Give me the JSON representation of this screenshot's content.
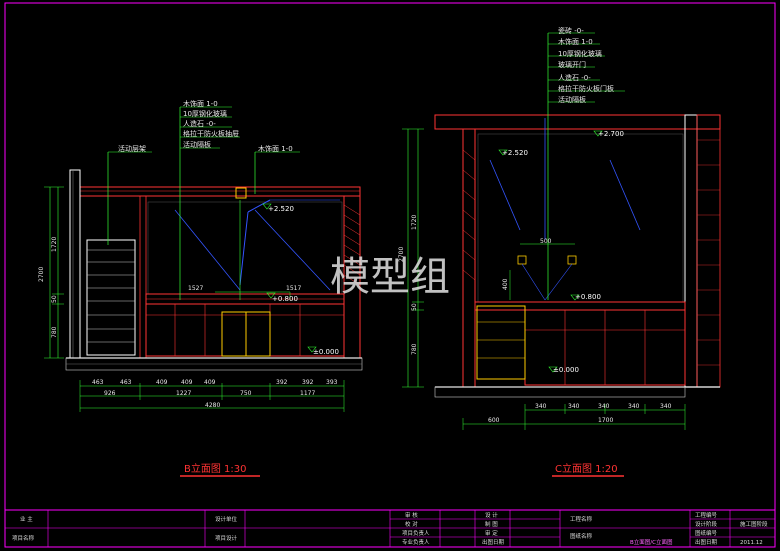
{
  "watermark": "模型组",
  "left_elevation": {
    "title": "B立面图 1:30",
    "callouts": [
      "木饰面 1-0",
      "10厚钢化玻璃",
      "人造石 -0-",
      "格拉干防火板抽屉",
      "活动隔板"
    ],
    "callout_left": "活动层架",
    "callout_right": "木饰面 1-0",
    "levels": [
      "+2.520",
      "+0.800",
      "±0.000"
    ],
    "dims_top": [
      "1527",
      "1517"
    ],
    "dims_row1": [
      "463",
      "463",
      "409",
      "409",
      "409",
      "392",
      "392",
      "393"
    ],
    "dims_row2": [
      "926",
      "1227",
      "750",
      "1177"
    ],
    "dims_total": "4280",
    "dims_vert": [
      "2700",
      "1720",
      "50",
      "780"
    ]
  },
  "right_elevation": {
    "title": "C立面图 1:20",
    "callouts": [
      "瓷砖 -0-",
      "木饰面 1-0",
      "10厚钢化玻璃",
      "玻璃开门",
      "人造石 -0-",
      "格拉干防火板门板",
      "活动隔板"
    ],
    "levels": [
      "+2.700",
      "+2.520",
      "+0.800",
      "±0.000"
    ],
    "dims_mid": [
      "500",
      "400"
    ],
    "dims_row1": [
      "340",
      "340",
      "340",
      "340",
      "340"
    ],
    "dims_row2": [
      "600",
      "1700"
    ],
    "dims_vert": [
      "2700",
      "1720",
      "50",
      "780"
    ]
  },
  "title_block": {
    "owner": "业 主",
    "project_name": "项目名称",
    "design_unit": "设计单位",
    "project_design": "项目设计",
    "review_col": [
      "审 核",
      "校 对",
      "项目负责人",
      "专业负责人"
    ],
    "design_col": [
      "设 计",
      "制 图",
      "审 定",
      "出图日期"
    ],
    "project_label": "工程名称",
    "drawing_label": "图纸名称",
    "drawing_name": "B立面图/C立面图",
    "meta_labels": [
      "工程编号",
      "设计阶段",
      "图纸编号",
      "出图日期"
    ],
    "meta_values": [
      "",
      "施工图阶段",
      "",
      "2011.12"
    ]
  }
}
